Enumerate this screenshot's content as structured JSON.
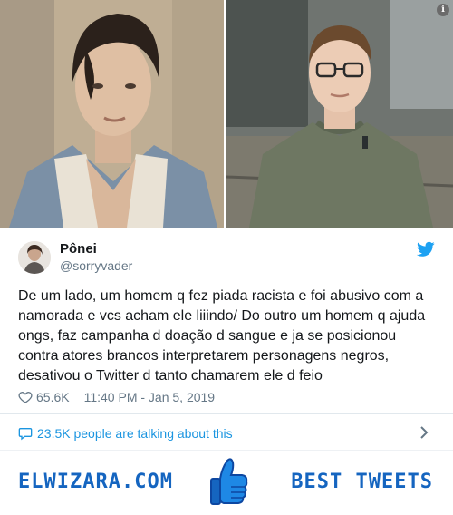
{
  "tweet": {
    "user_name": "Pônei",
    "user_handle": "@sorryvader",
    "text": "De um lado, um homem q fez piada racista e foi abusivo com a namorada e vcs acham ele liiindo/ Do outro um homem q ajuda ongs, faz campanha d doação d sangue e ja se posicionou contra atores brancos interpretarem personagens negros, desativou o Twitter d tanto chamarem ele d feio",
    "likes": "65.6K",
    "timestamp": "11:40 PM - Jan 5, 2019",
    "talking": "23.5K people are talking about this"
  },
  "footer": {
    "brand_left": "ELWIZARA.COM",
    "brand_right": "BEST TWEETS"
  },
  "icons": {
    "info": "info-icon",
    "twitter": "twitter-bird-icon",
    "heart": "heart-icon",
    "bubble": "speech-bubble-icon",
    "chevron": "chevron-right-icon",
    "thumbs": "thumbs-up-icon"
  },
  "colors": {
    "twitter_blue": "#1da1f2",
    "link_blue": "#1b95e0",
    "brand_blue": "#1565c0",
    "muted": "#657786"
  }
}
